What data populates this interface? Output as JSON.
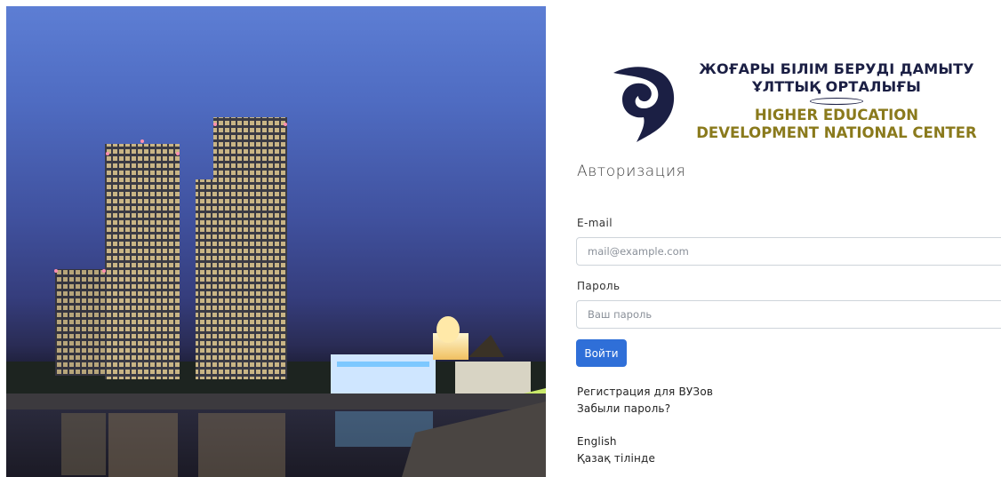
{
  "logo": {
    "line_kz_1": "ЖОҒАРЫ БІЛІМ БЕРУДІ ДАМЫТУ",
    "line_kz_2": "ҰЛТТЫҚ ОРТАЛЫҒЫ",
    "line_en_1": "HIGHER EDUCATION",
    "line_en_2": "DEVELOPMENT NATIONAL  CENTER",
    "icon": "logo-emblem-icon"
  },
  "login": {
    "title": "Авторизация",
    "email_label": "E-mail",
    "email_value": "",
    "email_placeholder": "mail@example.com",
    "password_label": "Пароль",
    "password_value": "",
    "password_placeholder": "Ваш пароль",
    "submit_label": "Войти"
  },
  "links": {
    "register": "Регистрация для ВУЗов",
    "forgot": "Забыли пароль?",
    "lang_en": "English",
    "lang_kz": "Қазақ тілінде"
  },
  "colors": {
    "primary": "#2f6fd8",
    "logo_dark": "#1b1f44",
    "logo_gold": "#8a7a1c"
  }
}
